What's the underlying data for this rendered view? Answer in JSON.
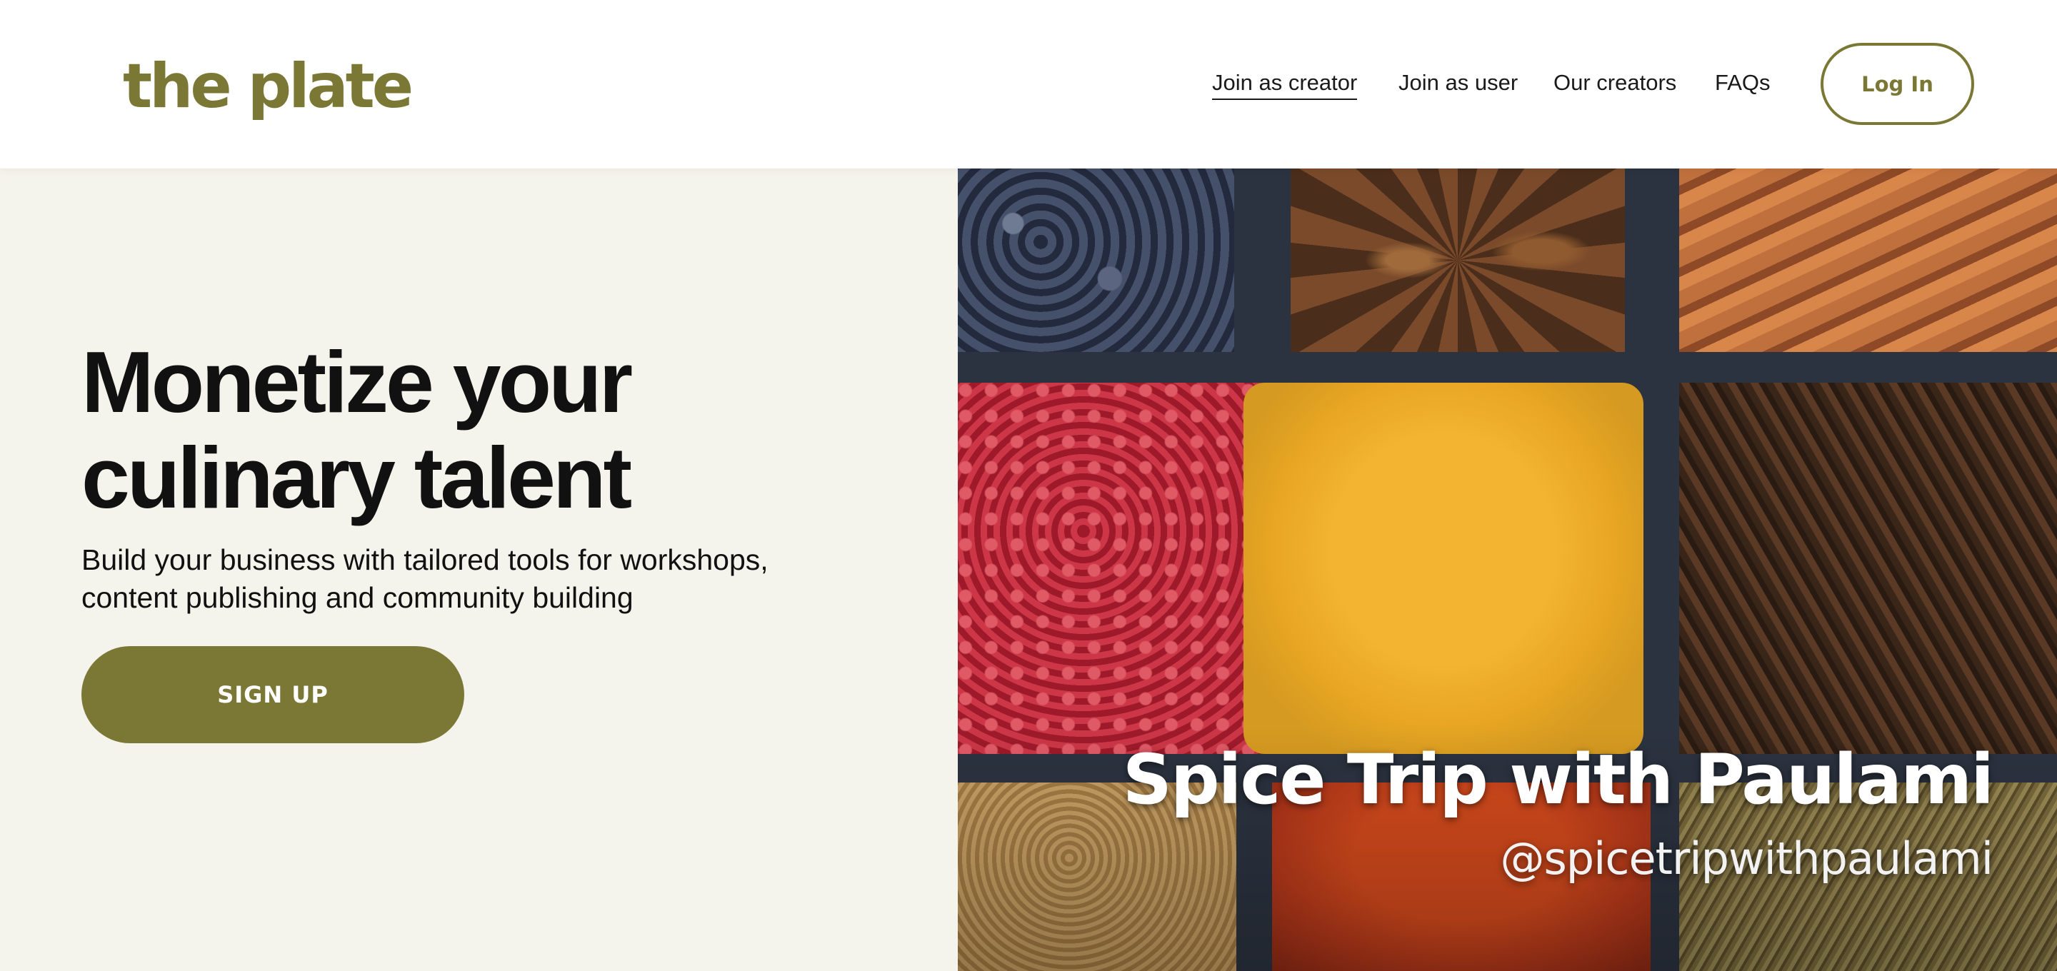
{
  "header": {
    "logo": "the plate",
    "nav": [
      {
        "label": "Join as creator",
        "active": true
      },
      {
        "label": "Join as user",
        "active": false
      },
      {
        "label": "Our creators",
        "active": false
      },
      {
        "label": "FAQs",
        "active": false
      }
    ],
    "login_label": "Log In"
  },
  "hero": {
    "title_line1": "Monetize your",
    "title_line2": "culinary talent",
    "subtitle_line1": "Build your business with tailored tools for workshops,",
    "subtitle_line2": "content publishing and community building",
    "signup_label": "SIGN UP",
    "image": {
      "title": "Spice Trip with Paulami",
      "handle": "@spicetripwithpaulami"
    }
  },
  "colors": {
    "brand": "#7a7834",
    "hero_bg": "#f5f4ec",
    "text": "#111111",
    "white": "#ffffff"
  }
}
